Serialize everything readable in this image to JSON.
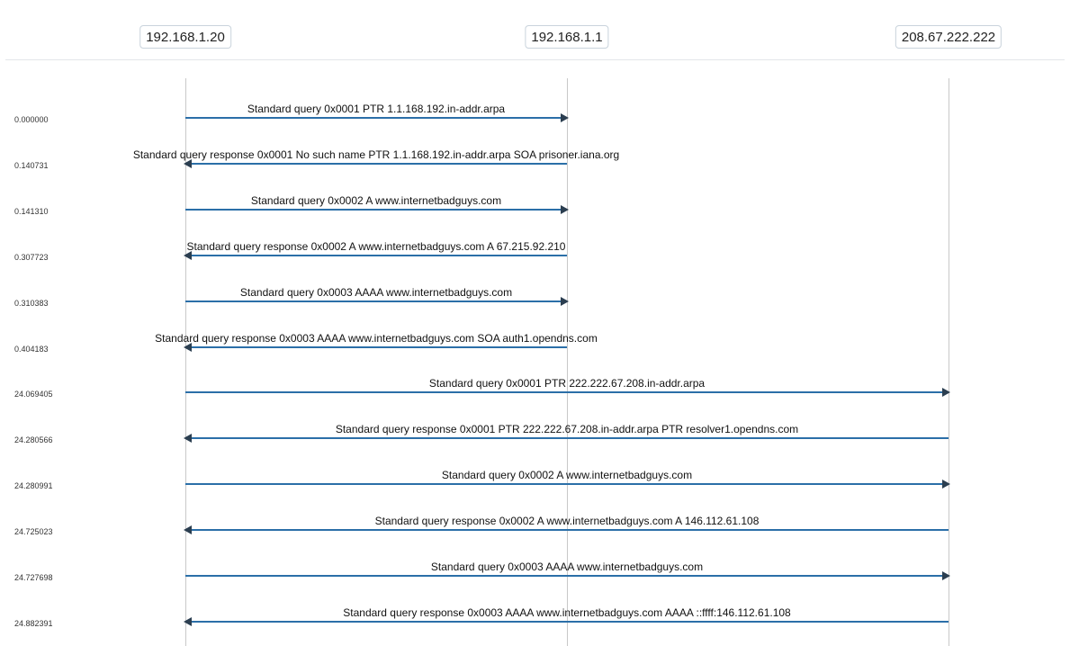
{
  "hosts": [
    "192.168.1.20",
    "192.168.1.1",
    "208.67.222.222"
  ],
  "messages": [
    {
      "time": "0.000000",
      "from": 0,
      "to": 1,
      "label": "Standard query 0x0001 PTR 1.1.168.192.in-addr.arpa"
    },
    {
      "time": "0.140731",
      "from": 1,
      "to": 0,
      "label": "Standard query response 0x0001 No such name PTR 1.1.168.192.in-addr.arpa SOA prisoner.iana.org"
    },
    {
      "time": "0.141310",
      "from": 0,
      "to": 1,
      "label": "Standard query 0x0002 A www.internetbadguys.com"
    },
    {
      "time": "0.307723",
      "from": 1,
      "to": 0,
      "label": "Standard query response 0x0002 A www.internetbadguys.com A 67.215.92.210"
    },
    {
      "time": "0.310383",
      "from": 0,
      "to": 1,
      "label": "Standard query 0x0003 AAAA www.internetbadguys.com"
    },
    {
      "time": "0.404183",
      "from": 1,
      "to": 0,
      "label": "Standard query response 0x0003 AAAA www.internetbadguys.com SOA auth1.opendns.com"
    },
    {
      "time": "24.069405",
      "from": 0,
      "to": 2,
      "label": "Standard query 0x0001 PTR 222.222.67.208.in-addr.arpa"
    },
    {
      "time": "24.280566",
      "from": 2,
      "to": 0,
      "label": "Standard query response 0x0001 PTR 222.222.67.208.in-addr.arpa PTR resolver1.opendns.com"
    },
    {
      "time": "24.280991",
      "from": 0,
      "to": 2,
      "label": "Standard query 0x0002 A www.internetbadguys.com"
    },
    {
      "time": "24.725023",
      "from": 2,
      "to": 0,
      "label": "Standard query response 0x0002 A www.internetbadguys.com A 146.112.61.108"
    },
    {
      "time": "24.727698",
      "from": 0,
      "to": 2,
      "label": "Standard query 0x0003 AAAA www.internetbadguys.com"
    },
    {
      "time": "24.882391",
      "from": 2,
      "to": 0,
      "label": "Standard query response 0x0003 AAAA www.internetbadguys.com AAAA ::ffff:146.112.61.108"
    }
  ]
}
